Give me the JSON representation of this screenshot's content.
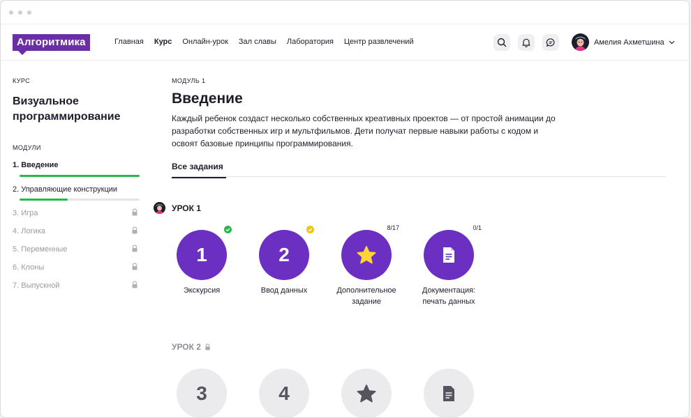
{
  "brand": {
    "logo": "Алгоритмика",
    "accent": "#6b2fa4",
    "circle_color": "#6b2fc2",
    "success": "#27b84a",
    "warning": "#f2c500"
  },
  "nav": [
    {
      "label": "Главная",
      "active": false
    },
    {
      "label": "Курс",
      "active": true
    },
    {
      "label": "Онлайн-урок",
      "active": false
    },
    {
      "label": "Зал славы",
      "active": false
    },
    {
      "label": "Лаборатория",
      "active": false
    },
    {
      "label": "Центр развлечений",
      "active": false
    }
  ],
  "header_icons": [
    "search-icon",
    "bell-icon",
    "chat-icon"
  ],
  "user": {
    "name": "Амелия Ахметшина"
  },
  "sidebar": {
    "course_label": "КУРС",
    "course_title": "Визуальное программирование",
    "modules_label": "МОДУЛИ",
    "modules": [
      {
        "label": "1. Введение",
        "locked": false,
        "bold": true,
        "progress": 1.0
      },
      {
        "label": "2. Управляющие конструкции",
        "locked": false,
        "bold": false,
        "progress": 0.4
      },
      {
        "label": "3. Игра",
        "locked": true
      },
      {
        "label": "4. Логика",
        "locked": true
      },
      {
        "label": "5. Переменные",
        "locked": true
      },
      {
        "label": "6. Клоны",
        "locked": true
      },
      {
        "label": "7. Выпускной",
        "locked": true
      }
    ]
  },
  "main": {
    "module_num": "МОДУЛЬ 1",
    "title": "Введение",
    "description": "Каждый ребенок создаст несколько собственных креативных проектов — от простой анимации до разработки собственных игр и мультфильмов. Дети получат первые навыки работы с кодом и освоят базовые принципы программирования.",
    "tab": "Все задания"
  },
  "lessons": [
    {
      "title": "УРОК 1",
      "locked": false,
      "tasks": [
        {
          "symbol": "1",
          "label": "Экскурсия",
          "status": "done"
        },
        {
          "symbol": "2",
          "label": "Ввод данных",
          "status": "partial"
        },
        {
          "symbol": "star-icon",
          "label": "Дополнительное задание",
          "count": "8/17"
        },
        {
          "symbol": "document-icon",
          "label": "Документация: печать данных",
          "count": "0/1"
        }
      ]
    },
    {
      "title": "УРОК 2",
      "locked": true,
      "tasks": [
        {
          "symbol": "3"
        },
        {
          "symbol": "4"
        },
        {
          "symbol": "star-icon"
        },
        {
          "symbol": "document-icon"
        }
      ]
    }
  ]
}
